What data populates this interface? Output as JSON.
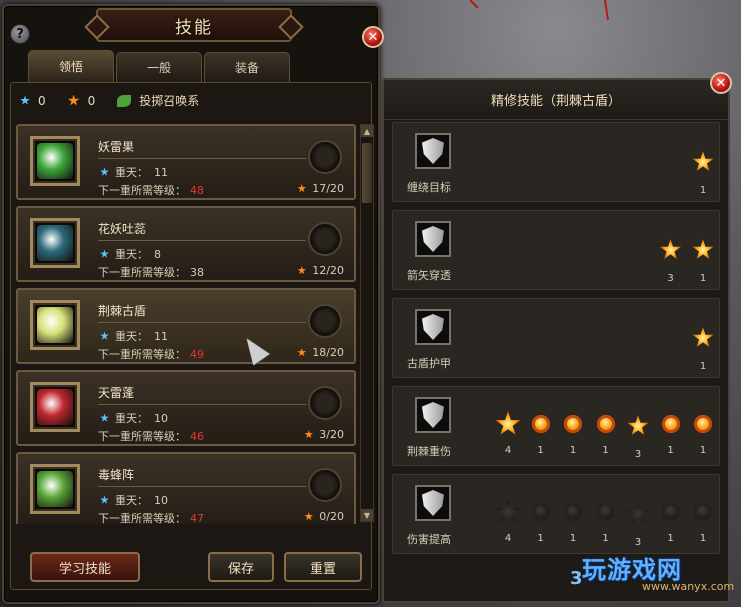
{
  "window": {
    "title": "技能",
    "help_label": "?",
    "close_label": "✕"
  },
  "tabs": [
    {
      "label": "领悟",
      "active": true
    },
    {
      "label": "一般",
      "active": false
    },
    {
      "label": "装备",
      "active": false
    }
  ],
  "points": {
    "blue": "0",
    "orange": "0",
    "school": "投掷召唤系"
  },
  "labels": {
    "heaven_prefix": "重天：",
    "next_level_prefix": "下一重所需等级："
  },
  "skills": [
    {
      "name": "妖雷果",
      "heaven": "11",
      "next_level": "48",
      "progress": "17/20",
      "next_level_red": true,
      "icon_color": "#3fa63a"
    },
    {
      "name": "花妖吐蕊",
      "heaven": "8",
      "next_level": "38",
      "progress": "12/20",
      "next_level_red": false,
      "icon_color": "#2c6a7a"
    },
    {
      "name": "荆棘古盾",
      "heaven": "11",
      "next_level": "49",
      "progress": "18/20",
      "next_level_red": true,
      "icon_color": "#d8e27a",
      "selected": true
    },
    {
      "name": "天雷蓬",
      "heaven": "10",
      "next_level": "46",
      "progress": "3/20",
      "next_level_red": true,
      "icon_color": "#c0282e"
    },
    {
      "name": "毒蜂阵",
      "heaven": "10",
      "next_level": "47",
      "progress": "0/20",
      "next_level_red": true,
      "icon_color": "#5aa63a"
    }
  ],
  "buttons": {
    "learn": "学习技能",
    "save": "保存",
    "reset": "重置"
  },
  "refine": {
    "title": "精修技能（荆棘古盾）",
    "rows": [
      {
        "name": "缠绕目标",
        "stars": [
          {
            "type": "star",
            "value": "1",
            "active": true
          }
        ]
      },
      {
        "name": "箭矢穿透",
        "stars": [
          {
            "type": "star",
            "value": "3",
            "active": true
          },
          {
            "type": "star",
            "value": "1",
            "active": true
          }
        ]
      },
      {
        "name": "古盾护甲",
        "stars": [
          {
            "type": "star",
            "value": "1",
            "active": true
          }
        ]
      },
      {
        "name": "荆棘重伤",
        "stars": [
          {
            "type": "big",
            "value": "4",
            "active": true
          },
          {
            "type": "ball",
            "value": "1",
            "active": true
          },
          {
            "type": "ball",
            "value": "1",
            "active": true
          },
          {
            "type": "ball",
            "value": "1",
            "active": true
          },
          {
            "type": "star",
            "value": "3",
            "active": true
          },
          {
            "type": "ball",
            "value": "1",
            "active": true
          },
          {
            "type": "ball",
            "value": "1",
            "active": true
          }
        ]
      },
      {
        "name": "伤害提高",
        "stars": [
          {
            "type": "big",
            "value": "4",
            "active": false
          },
          {
            "type": "ball",
            "value": "1",
            "active": false
          },
          {
            "type": "ball",
            "value": "1",
            "active": false
          },
          {
            "type": "ball",
            "value": "1",
            "active": false
          },
          {
            "type": "star",
            "value": "3",
            "active": false
          },
          {
            "type": "ball",
            "value": "1",
            "active": false
          },
          {
            "type": "ball",
            "value": "1",
            "active": false
          }
        ]
      }
    ]
  },
  "watermark": {
    "prefix": "3",
    "text": "玩游戏网",
    "sub": "www.wanyx.com"
  },
  "colors": {
    "red_level": "#e23a2a",
    "orange_star": "#ff8a1a",
    "blue_star": "#59c4ff"
  }
}
